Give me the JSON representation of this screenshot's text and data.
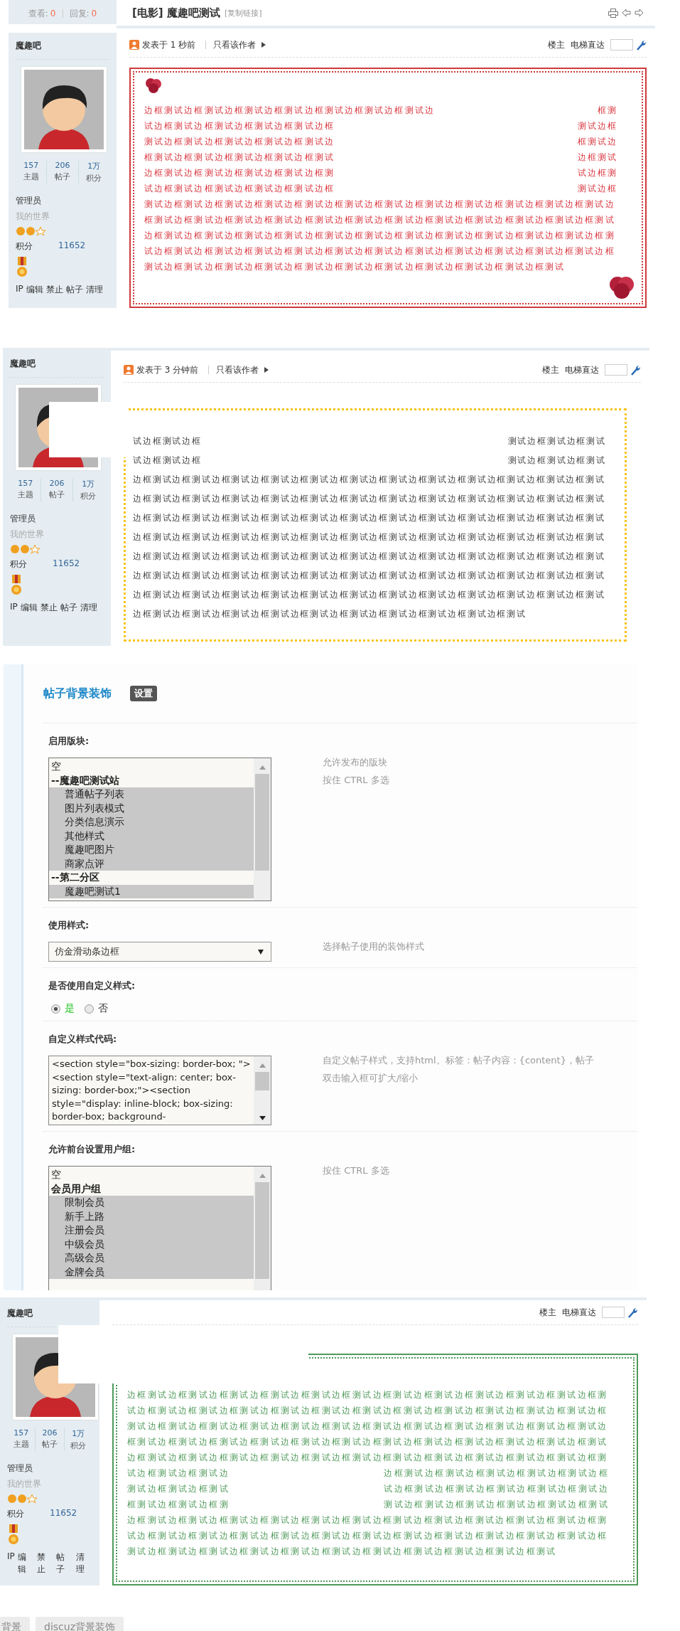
{
  "posts": [
    {
      "kind": "red-frame",
      "header": {
        "views_label": "查看:",
        "views": "0",
        "replies_label": "回复:",
        "replies": "0",
        "title": "[电影] 魔趣吧测试",
        "copy_link": "[复制链接]"
      },
      "author": {
        "name": "魔趣吧",
        "stats": [
          {
            "value": "157",
            "label": "主题"
          },
          {
            "value": "206",
            "label": "帖子"
          },
          {
            "value": "1万",
            "label": "积分"
          }
        ],
        "group": "管理员",
        "title": "我的世界",
        "points_label": "积分",
        "points": "11652",
        "actions": [
          "IP",
          "编辑",
          "禁止",
          "帖子",
          "清理"
        ]
      },
      "meta": {
        "posted": "发表于 1 秒前",
        "only_author": "只看该作者",
        "floor": "楼主",
        "jump": "电梯直达"
      },
      "lines": [
        [
          "边框测试边框测试边框测试边框测试边框测试边框测试边框测试边",
          "框测"
        ],
        [
          "试边框测试边框测试边框测试边框测试边框",
          "测试边框"
        ],
        [
          "测试边框测试边框测试边框测试边框测试边",
          "框测试边"
        ],
        [
          "框测试边框测试边框测试边框测试边框测试",
          "边框测试"
        ],
        [
          "边框测试边框测试边框测试边框测试边框测",
          "试边框测"
        ],
        [
          "试边框测试边框测试边框测试边框测试边框",
          "测试边框"
        ],
        [
          "测试边框测试边框测试边框测试边框测试边框测试边框测试边框测试边框测试边框测试边框测试边框测试边"
        ],
        [
          "框测试边框测试边框测试边框测试边框测试边框测试边框测试边框测试边框测试边框测试边框测试边框测试"
        ],
        [
          "边框测试边框测试边框测试边框测试边框测试边框测试边框测试边框测试边框测试边框测试边框测试边框测"
        ],
        [
          "试边框测试边框测试边框测试边框测试边框测试边框测试边框测试边框测试边框测试边框测试边框测试边框"
        ],
        [
          "测试边框测试边框测试边框测试边框测试边框测试边框测试边框测试边框测试边框测试边框测试"
        ]
      ]
    },
    {
      "kind": "gold-frame",
      "author": {
        "name": "魔趣吧",
        "stats": [
          {
            "value": "157",
            "label": "主题"
          },
          {
            "value": "206",
            "label": "帖子"
          },
          {
            "value": "1万",
            "label": "积分"
          }
        ],
        "group": "管理员",
        "title": "我的世界",
        "points_label": "积分",
        "points": "11652",
        "actions": [
          "IP",
          "编辑",
          "禁止",
          "帖子",
          "清理"
        ]
      },
      "meta": {
        "posted": "发表于 3 分钟前",
        "only_author": "只看该作者",
        "floor": "楼主",
        "jump": "电梯直达"
      },
      "lines": [
        [
          "试边框测试边框",
          "测试边框测试边框测试"
        ],
        [
          "试边框测试边框",
          "测试边框测试边框测试"
        ],
        [
          "边框测试边框测试边框测试边框测试边框测试边框测试边框测试边框测试边框测试边框测试边框测试边框测试"
        ],
        [
          "边框测试边框测试边框测试边框测试边框测试边框测试边框测试边框测试边框测试边框测试边框测试边框测试"
        ],
        [
          "边框测试边框测试边框测试边框测试边框测试边框测试边框测试边框测试边框测试边框测试边框测试边框测试"
        ],
        [
          "边框测试边框测试边框测试边框测试边框测试边框测试边框测试边框测试边框测试边框测试边框测试边框测试"
        ],
        [
          "边框测试边框测试边框测试边框测试边框测试边框测试边框测试边框测试边框测试边框测试边框测试边框测试"
        ],
        [
          "边框测试边框测试边框测试边框测试边框测试边框测试边框测试边框测试边框测试边框测试边框测试边框测试"
        ],
        [
          "边框测试边框测试边框测试边框测试边框测试边框测试边框测试边框测试边框测试边框测试边框测试边框测试"
        ],
        [
          "边框测试边框测试边框测试边框测试边框测试边框测试边框测试边框测试边框测试边框测试"
        ]
      ]
    }
  ],
  "settings": {
    "title": "帖子背景装饰",
    "badge": "设置",
    "fields": [
      {
        "kind": "listbox",
        "label": "启用版块:",
        "options": [
          {
            "text": "空",
            "group": false,
            "selected": false
          },
          {
            "text": "--魔趣吧测试站",
            "group": true,
            "selected": false
          },
          {
            "text": "普通帖子列表",
            "group": false,
            "selected": true
          },
          {
            "text": "图片列表模式",
            "group": false,
            "selected": true
          },
          {
            "text": "分类信息演示",
            "group": false,
            "selected": true
          },
          {
            "text": "其他样式",
            "group": false,
            "selected": true
          },
          {
            "text": "魔趣吧图片",
            "group": false,
            "selected": true
          },
          {
            "text": "商家点评",
            "group": false,
            "selected": true
          },
          {
            "text": "--第二分区",
            "group": true,
            "selected": false
          },
          {
            "text": "魔趣吧测试1",
            "group": false,
            "selected": true
          }
        ],
        "hints": [
          "允许发布的版块",
          "按住 CTRL 多选"
        ]
      },
      {
        "kind": "select",
        "label": "使用样式:",
        "value": "仿金滑动条边框",
        "hints": [
          "选择帖子使用的装饰样式"
        ]
      },
      {
        "kind": "radio",
        "label": "是否使用自定义样式:",
        "options": [
          {
            "text": "是",
            "selected": true
          },
          {
            "text": "否",
            "selected": false
          }
        ]
      },
      {
        "kind": "textarea",
        "label": "自定义样式代码:",
        "value": "<section style=\"box-sizing: border-box; \"><section style=\"text-align: center; box-sizing: border-box;\"><section style=\"display: inline-block; box-sizing: border-box; background-",
        "hints": [
          "自定义帖子样式，支持html。标签：帖子内容：{content}，帖子",
          "双击输入框可扩大/缩小"
        ]
      },
      {
        "kind": "listbox",
        "label": "允许前台设置用户组:",
        "options": [
          {
            "text": "空",
            "group": false,
            "selected": false
          },
          {
            "text": "会员用户组",
            "group": true,
            "selected": false
          },
          {
            "text": "限制会员",
            "group": false,
            "selected": true
          },
          {
            "text": "新手上路",
            "group": false,
            "selected": true
          },
          {
            "text": "注册会员",
            "group": false,
            "selected": true
          },
          {
            "text": "中级会员",
            "group": false,
            "selected": true
          },
          {
            "text": "高级会员",
            "group": false,
            "selected": true
          },
          {
            "text": "金牌会员",
            "group": false,
            "selected": true
          }
        ],
        "hints": [
          "按住 CTRL 多选"
        ]
      }
    ]
  },
  "posts_after": [
    {
      "kind": "green-frame",
      "author": {
        "name": "魔趣吧",
        "stats": [
          {
            "value": "157",
            "label": "主题"
          },
          {
            "value": "206",
            "label": "帖子"
          },
          {
            "value": "1万",
            "label": "积分"
          }
        ],
        "group": "管理员",
        "title": "我的世界",
        "points_label": "积分",
        "points": "11652",
        "actions": [
          "IP",
          "编辑",
          "禁止",
          "帖子",
          "清理"
        ]
      },
      "meta": {
        "floor": "楼主",
        "jump": "电梯直达"
      },
      "lines": [
        [
          "边框测试边框测试边框测试边框测试边框测试边框测试边框测试边框测试边框测试边框测试边框测试边框测"
        ],
        [
          "试边框测试边框测试边框测试边框测试边框测试边框测试边框测试边框测试边框测试边框测试边框测试边框"
        ],
        [
          "测试边框测试边框测试边框测试边框测试边框测试边框测试边框测试边框测试边框测试边框测试边框测试边"
        ],
        [
          "框测试边框测试边框测试边框测试边框测试边框测试边框测试边框测试边框测试边框测试边框测试边框测试"
        ],
        [
          "边框测试边框测试边框测试边框测试边框测试边框测试边框测试边框测试边框测试边框测试边框测试边框测"
        ],
        [
          "试边框测试边框测试边",
          "边框测试边框测试边框测试边框测试边框测试边框"
        ],
        [
          "测试边框测试边框测试",
          "试边框测试边框测试边框测试边框测试边框测试边"
        ],
        [
          "框测试边框测试边框测",
          "测试边框测试边框测试边框测试边框测试边框测试"
        ],
        [
          "边框测试边框测试边框测试边框测试边框测试边框测试边框测试边框测试边框测试边框测试边框测试边框测"
        ],
        [
          "试边框测试边框测试边框测试边框测试边框测试边框测试边框测试边框测试边框测试边框测试边框测试边框"
        ],
        [
          "测试边框测试边框测试边框测试边框测试边框测试边框测试边框测试边框测试边框测试边框测试"
        ]
      ]
    }
  ],
  "tags": [
    "背景",
    "discuz背景装饰"
  ]
}
